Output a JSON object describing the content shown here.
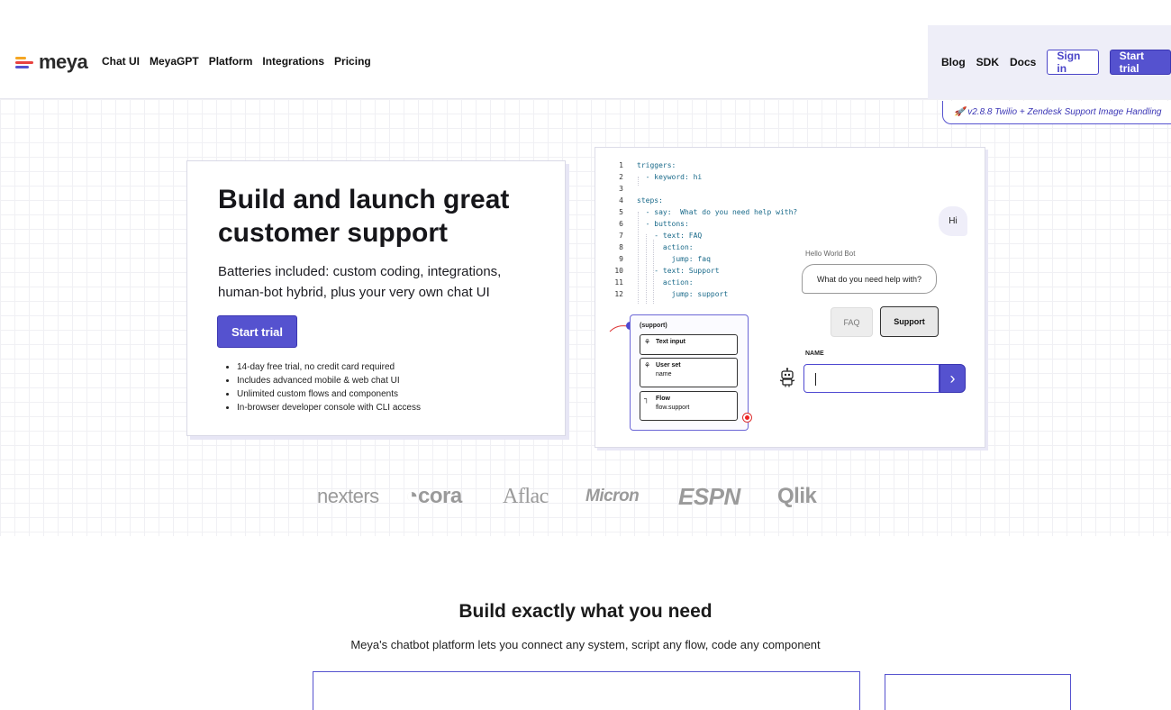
{
  "brand": {
    "name": "meya",
    "colors": {
      "accent": "#5552cf",
      "accent_dark": "#3a35b2",
      "mark_bars": [
        "#f5a623",
        "#e8423f",
        "#5552cf"
      ]
    }
  },
  "nav": {
    "left": [
      "Chat UI",
      "MeyaGPT",
      "Platform",
      "Integrations",
      "Pricing"
    ],
    "right_links": [
      "Blog",
      "SDK",
      "Docs"
    ],
    "sign_in": "Sign in",
    "start_trial": "Start trial"
  },
  "announcement": "🚀 v2.8.8 Twilio + Zendesk Support Image Handling",
  "hero": {
    "title": "Build and launch great customer support",
    "subtitle": "Batteries included: custom coding, integrations, human-bot hybrid, plus your very own chat UI",
    "cta": "Start trial",
    "bullets": [
      "14-day free trial, no credit card required",
      "Includes advanced mobile & web chat UI",
      "Unlimited custom flows and components",
      "In-browser developer console with CLI access"
    ]
  },
  "demo": {
    "code": [
      {
        "n": "1",
        "text": "triggers:"
      },
      {
        "n": "2",
        "text": "  - keyword: hi"
      },
      {
        "n": "3",
        "text": ""
      },
      {
        "n": "4",
        "text": "steps:"
      },
      {
        "n": "5",
        "text": "  - say:  What do you need help with?"
      },
      {
        "n": "6",
        "text": "  - buttons:"
      },
      {
        "n": "7",
        "text": "    - text: FAQ"
      },
      {
        "n": "8",
        "text": "      action:"
      },
      {
        "n": "9",
        "text": "        jump: faq"
      },
      {
        "n": "10",
        "text": "    - text: Support"
      },
      {
        "n": "11",
        "text": "      action:"
      },
      {
        "n": "12",
        "text": "        jump: support"
      }
    ],
    "flow": {
      "label": "(support)",
      "items": [
        {
          "title": "Text input",
          "sub": ""
        },
        {
          "title": "User set",
          "sub": "name"
        },
        {
          "title": "Flow",
          "sub": "flow.support"
        }
      ]
    },
    "chat": {
      "user_message": "Hi",
      "bot_name": "Hello World Bot",
      "bot_message": "What do you need help with?",
      "quick_replies": [
        "FAQ",
        "Support"
      ],
      "field_label": "NAME",
      "input_value": ""
    }
  },
  "customers": [
    "nexters",
    "cora",
    "Aflac",
    "Micron",
    "ESPN",
    "Qlik"
  ],
  "section": {
    "title": "Build exactly what you need",
    "subtitle": "Meya's chatbot platform lets you connect any system, script any flow, code any component"
  }
}
